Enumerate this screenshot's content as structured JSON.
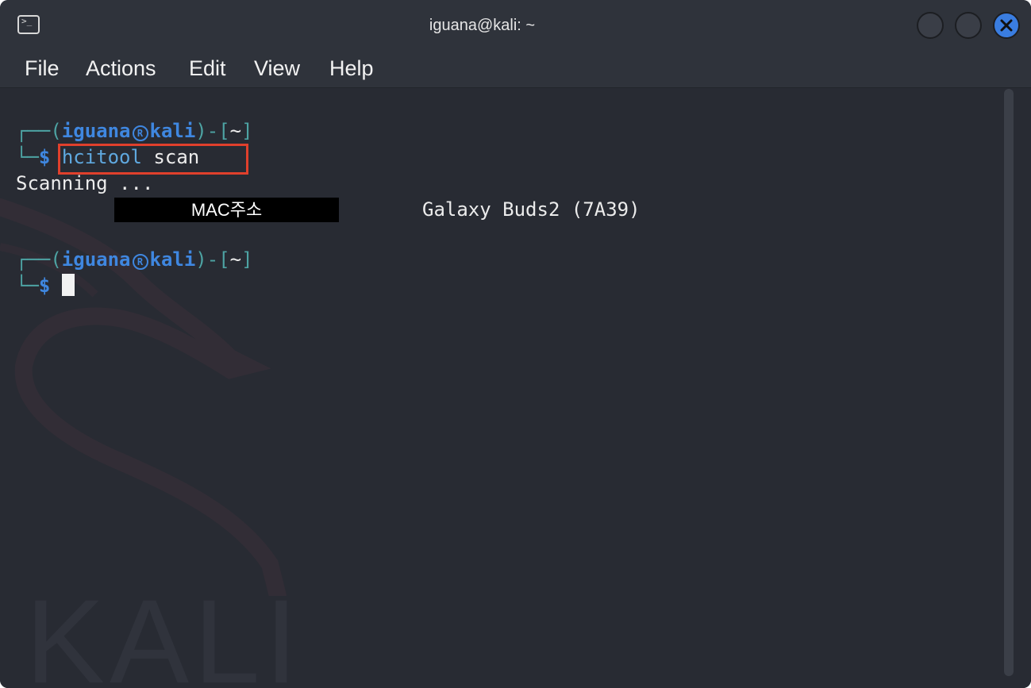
{
  "window": {
    "title": "iguana@kali: ~",
    "app_icon_glyph": ">_",
    "accent_color": "#3a7de0"
  },
  "menu": {
    "items": [
      "File",
      "Actions",
      "Edit",
      "View",
      "Help"
    ]
  },
  "terminal": {
    "prompt1": {
      "corner_top": "┌──(",
      "user": "iguana",
      "reg_symbol": "㉿",
      "host": "kali",
      "mid": ")-[",
      "dir": "~",
      "close": "]",
      "corner_bottom": "└─",
      "dollar": "$",
      "command_name": "hcitool",
      "command_arg": "scan"
    },
    "output_scanning": "Scanning ...",
    "redacted_label": "MAC주소",
    "device_name": "Galaxy Buds2 (7A39)",
    "prompt2": {
      "corner_top": "┌──(",
      "user": "iguana",
      "reg_symbol": "㉿",
      "host": "kali",
      "mid": ")-[",
      "dir": "~",
      "close": "]",
      "corner_bottom": "└─",
      "dollar": "$"
    },
    "watermark_text": "KALI",
    "colors": {
      "background": "#282b33",
      "prompt_frame": "#4da3a3",
      "prompt_user": "#3f87e0",
      "command": "#5fa8df",
      "highlight": "#e0402c"
    }
  }
}
